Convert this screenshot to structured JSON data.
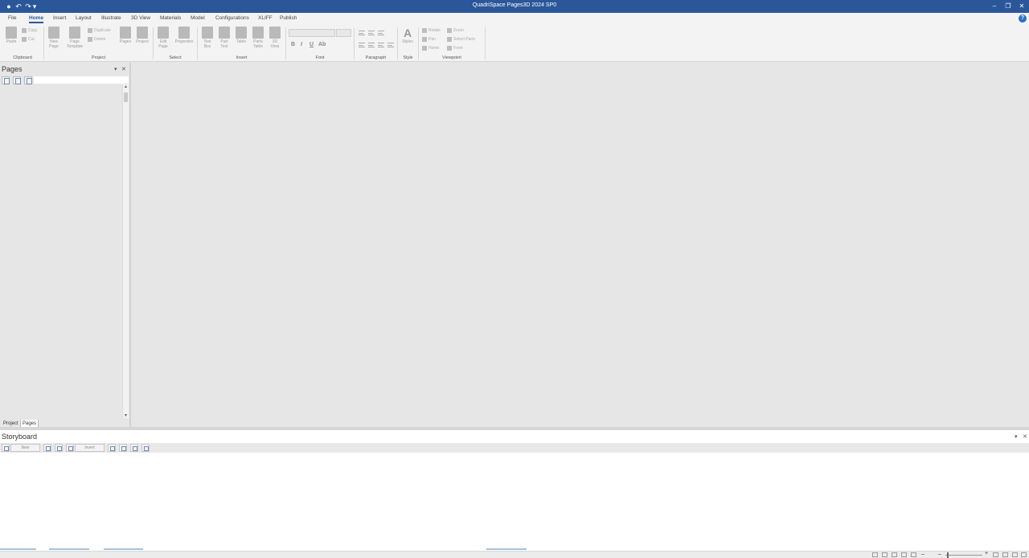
{
  "app": {
    "title": "QuadriSpace Pages3D  2024 SP0"
  },
  "quick_access": {
    "undo": "↶",
    "redo": "↷",
    "dropdown": "▾"
  },
  "window": {
    "minimize": "–",
    "restore": "❐",
    "close": "✕"
  },
  "ribbon_tabs": [
    "File",
    "Home",
    "Insert",
    "Layout",
    "Illustrate",
    "3D View",
    "Materials",
    "Model",
    "Configurations",
    "XLIFF",
    "Publish"
  ],
  "active_tab": "Home",
  "help": "?",
  "groups": {
    "clipboard": {
      "label": "Clipboard",
      "paste": "Paste",
      "copy": "Copy",
      "cut": "Cut"
    },
    "project": {
      "label": "Project",
      "new_page_1": "New",
      "new_page_2": "Page",
      "page_template_1": "Page",
      "page_template_2": "Template",
      "duplicate": "Duplicate",
      "delete": "Delete",
      "pages": "Pages",
      "project_btn": "Project"
    },
    "select": {
      "label": "Select",
      "edit_page_1": "Edit",
      "edit_page_2": "Page",
      "properties": "Properties"
    },
    "insert": {
      "label": "Insert",
      "text_box_1": "Text",
      "text_box_2": "Box",
      "part_text_1": "Part",
      "part_text_2": "Text",
      "table": "Table",
      "parts_table_1": "Parts",
      "parts_table_2": "Table",
      "view3d_1": "3D",
      "view3d_2": "View"
    },
    "font": {
      "label": "Font",
      "bold": "B",
      "italic": "I",
      "underline": "U",
      "color": "Ab"
    },
    "paragraph": {
      "label": "Paragraph"
    },
    "style": {
      "label": "Style",
      "styles": "Styles"
    },
    "viewpoint": {
      "label": "Viewpoint",
      "rotate": "Rotate",
      "zoom": "Zoom",
      "pan": "Pan",
      "select_parts": "Select Parts",
      "home": "Home",
      "front": "Front"
    }
  },
  "pages_panel": {
    "title": "Pages",
    "pin": "▾",
    "close": "✕",
    "tab_project": "Project",
    "tab_pages": "Pages"
  },
  "storyboard": {
    "title": "Storyboard",
    "pin": "▾",
    "close": "✕",
    "new_btn": "New",
    "invert_btn": "Invert"
  },
  "status": {
    "zoom_minus": "–",
    "zoom_plus": "+",
    "zoom_level": 0.05
  }
}
